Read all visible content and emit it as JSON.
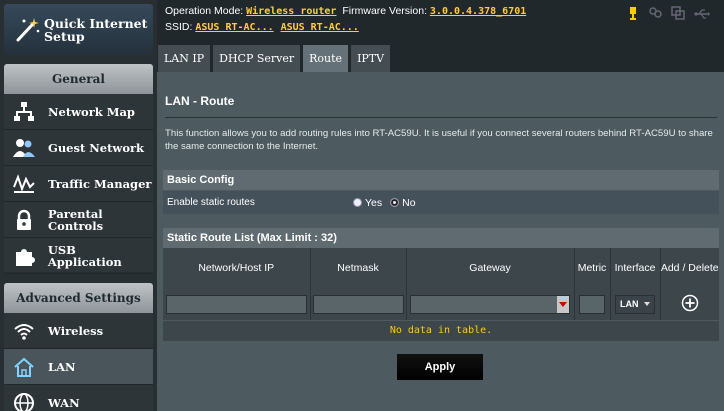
{
  "sidebar": {
    "quick_setup_label": "Quick Internet Setup",
    "general_header": "General",
    "general_items": [
      {
        "label": "Network Map",
        "icon": "network-map-icon"
      },
      {
        "label": "Guest Network",
        "icon": "guest-network-icon"
      },
      {
        "label": "Traffic Manager",
        "icon": "traffic-manager-icon"
      },
      {
        "label": "Parental Controls",
        "icon": "parental-controls-icon"
      },
      {
        "label": "USB Application",
        "icon": "usb-application-icon"
      }
    ],
    "advanced_header": "Advanced Settings",
    "advanced_items": [
      {
        "label": "Wireless",
        "icon": "wireless-icon"
      },
      {
        "label": "LAN",
        "icon": "lan-icon",
        "active": true
      },
      {
        "label": "WAN",
        "icon": "wan-icon"
      }
    ]
  },
  "status": {
    "operation_mode_label": "Operation Mode:",
    "operation_mode_value": "Wireless router",
    "firmware_label": "Firmware Version:",
    "firmware_value": "3.0.0.4.378_6701",
    "ssid_label": "SSID:",
    "ssid_values": [
      "ASUS RT-AC...",
      "ASUS RT-AC..."
    ]
  },
  "tabs": [
    {
      "label": "LAN IP"
    },
    {
      "label": "DHCP Server"
    },
    {
      "label": "Route",
      "active": true
    },
    {
      "label": "IPTV"
    }
  ],
  "main": {
    "title": "LAN - Route",
    "description": "This function allows you to add routing rules into RT-AC59U. It is useful if you connect several routers behind RT-AC59U to share the same connection to the Internet.",
    "basic_config_header": "Basic Config",
    "enable_static_label": "Enable static routes",
    "radio_yes": "Yes",
    "radio_no": "No",
    "static_enabled": "No",
    "static_list_header": "Static Route List (Max Limit : 32)",
    "columns": [
      "Network/Host IP",
      "Netmask",
      "Gateway",
      "Metric",
      "Interface",
      "Add / Delete"
    ],
    "interface_value": "LAN",
    "no_data": "No data in table.",
    "apply_label": "Apply"
  },
  "colors": {
    "accent_yellow": "#ffcc44",
    "panel": "#4d5a60",
    "dark_bg": "#20282b"
  }
}
